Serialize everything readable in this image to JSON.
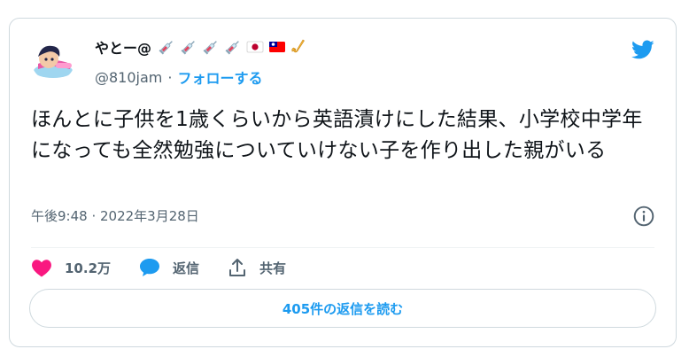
{
  "tweet": {
    "display_name": "やとー@",
    "handle": "@810jam",
    "separator": "·",
    "follow_label": "フォローする",
    "text": "ほんとに子供を1歳くらいから英語漬けにした結果、小学校中学年になっても全然勉強についていけない子を作り出した親がいる",
    "timestamp": "午後9:48 · 2022年3月28日",
    "name_emojis": [
      "syringe-icon",
      "syringe-icon",
      "syringe-icon",
      "syringe-icon",
      "japan-flag-icon",
      "taiwan-flag-icon",
      "saxophone-icon"
    ]
  },
  "actions": {
    "likes_count": "10.2万",
    "reply_label": "返信",
    "share_label": "共有"
  },
  "read_replies_label": "405件の返信を読む",
  "colors": {
    "accent": "#1d9bf0",
    "like": "#f91880",
    "text": "#0f1419",
    "muted": "#536471",
    "border": "#cfd9de"
  }
}
